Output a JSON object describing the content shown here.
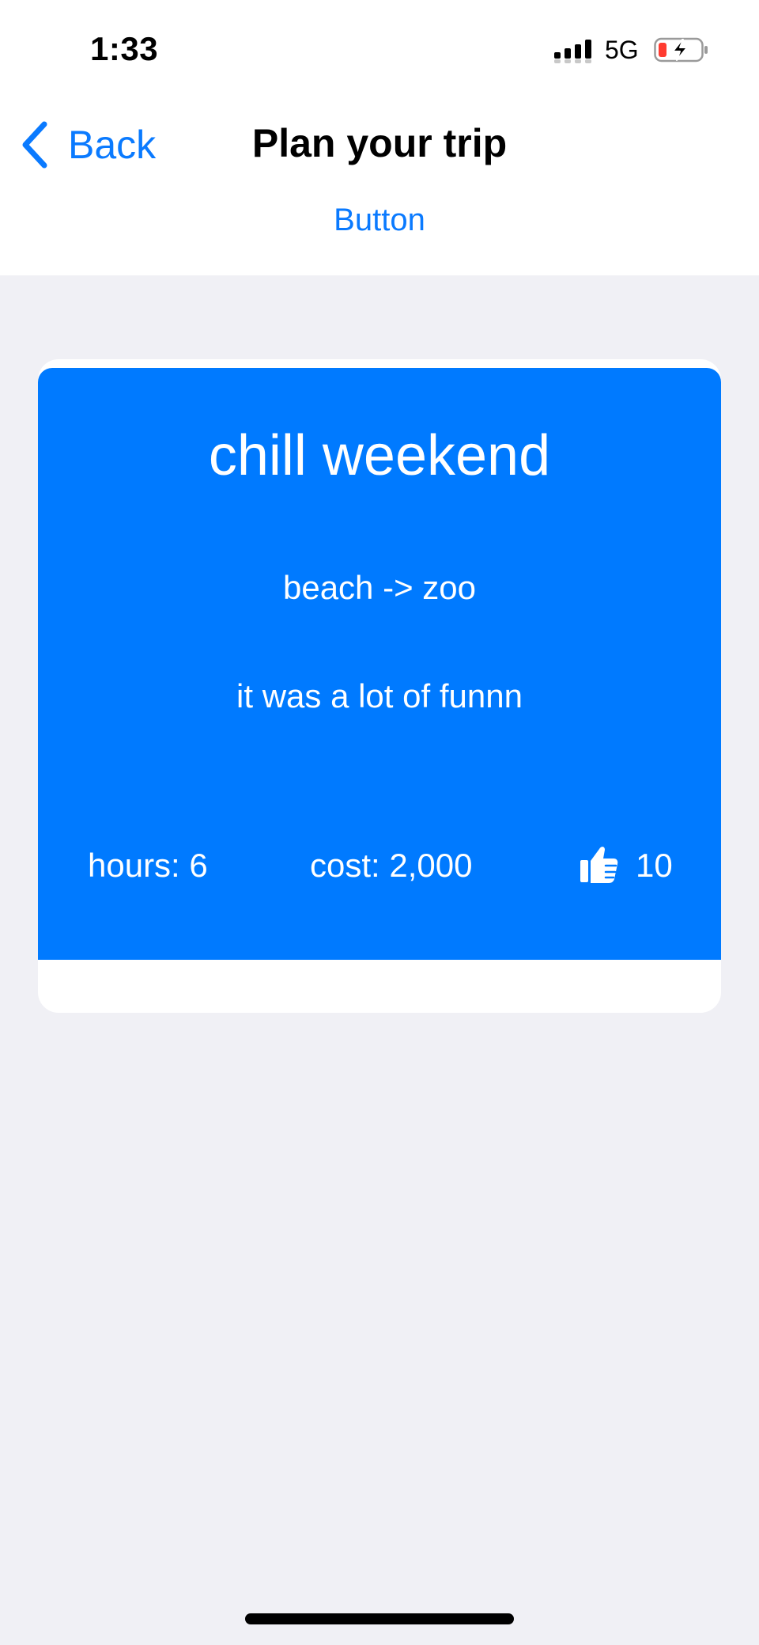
{
  "status_bar": {
    "time": "1:33",
    "network": "5G",
    "icons": [
      "signal-icon",
      "battery-charging-icon"
    ]
  },
  "nav": {
    "back_label": "Back",
    "title": "Plan your trip",
    "button_label": "Button"
  },
  "trip_card": {
    "title": "chill weekend",
    "route": "beach -> zoo",
    "description": "it was a lot of funnn",
    "hours": "hours: 6",
    "cost": "cost: 2,000",
    "likes": "10",
    "like_icon": "thumbs-up-icon"
  },
  "colors": {
    "accent": "#007aff",
    "link": "#0a7aff",
    "background": "#f0f0f5",
    "battery_low": "#ff3b30"
  }
}
